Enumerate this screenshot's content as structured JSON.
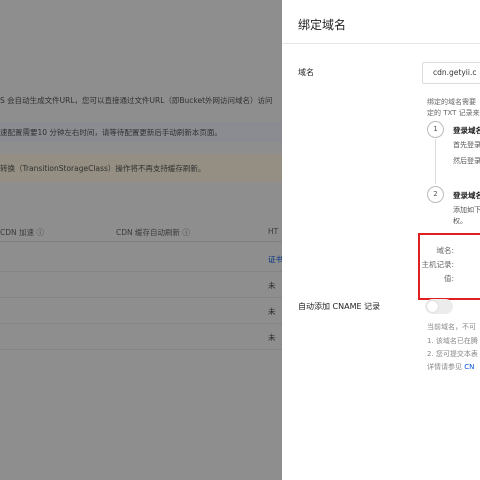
{
  "background": {
    "line1": "S 会自动生成文件URL，您可以直接通过文件URL（即Bucket外网访问域名）访问",
    "info": "速配置需要10 分钟左右时间，请等待配置更新后手动刷新本页面。",
    "warn": "转换（TransitionStorageClass）操作将不再支持缓存刷新。",
    "table_headers": [
      "CDN 加速 ⓘ",
      "CDN 缓存自动刷新 ⓘ",
      "HT"
    ],
    "rows": [
      {
        "c1": "",
        "c3": "证书"
      },
      {
        "c1": "",
        "c3": "未"
      },
      {
        "c1": "",
        "c3": "未"
      },
      {
        "c1": "",
        "c3": "未"
      }
    ]
  },
  "drawer": {
    "title": "绑定域名",
    "domain_label": "域名",
    "domain_value": "cdn.getyii.c",
    "desc_line1": "绑定的域名需要",
    "desc_line2": "定的 TXT 记录来",
    "step1_num": "1",
    "step1_title": "登录域名",
    "step1_text1": "首先登录",
    "step1_text2": "然后登录",
    "step2_num": "2",
    "step2_title": "登录域名",
    "step2_text1": "添加如下",
    "step2_text2": "权。",
    "record_domain_label": "域名:",
    "record_host_label": "主机记录:",
    "record_value_label": "值:",
    "cname_label": "自动添加 CNAME 记录",
    "note_line1": "当前域名，不可",
    "note_line2": "1. 该域名已在腾",
    "note_line3": "2. 您可提交本表",
    "note_line4_prefix": "详情请参见 ",
    "note_line4_link": "CN"
  }
}
